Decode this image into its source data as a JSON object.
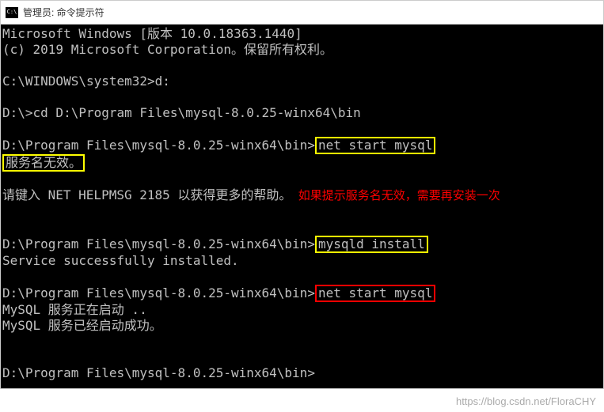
{
  "titlebar": {
    "title": "管理员: 命令提示符"
  },
  "terminal": {
    "header1": "Microsoft Windows [版本 10.0.18363.1440]",
    "header2": "(c) 2019 Microsoft Corporation。保留所有权利。",
    "line_prompt1": "C:\\WINDOWS\\system32>d:",
    "line_prompt2": "D:\\>cd D:\\Program Files\\mysql-8.0.25-winx64\\bin",
    "line3_prefix": "D:\\Program Files\\mysql-8.0.25-winx64\\bin>",
    "line3_cmd": "net start mysql",
    "line4_error": "服务名无效。",
    "line5_help": "请键入 NET HELPMSG 2185 以获得更多的帮助。",
    "annotation1": "  如果提示服务名无效，需要再安装一次",
    "line6_prefix": "D:\\Program Files\\mysql-8.0.25-winx64\\bin>",
    "line6_cmd": "mysqld install",
    "line7": "Service successfully installed.",
    "line8_prefix": "D:\\Program Files\\mysql-8.0.25-winx64\\bin>",
    "line8_cmd": "net start mysql",
    "line9": "MySQL 服务正在启动 ..",
    "line10": "MySQL 服务已经启动成功。",
    "line11_prompt": "D:\\Program Files\\mysql-8.0.25-winx64\\bin>"
  },
  "watermark": "https://blog.csdn.net/FloraCHY"
}
